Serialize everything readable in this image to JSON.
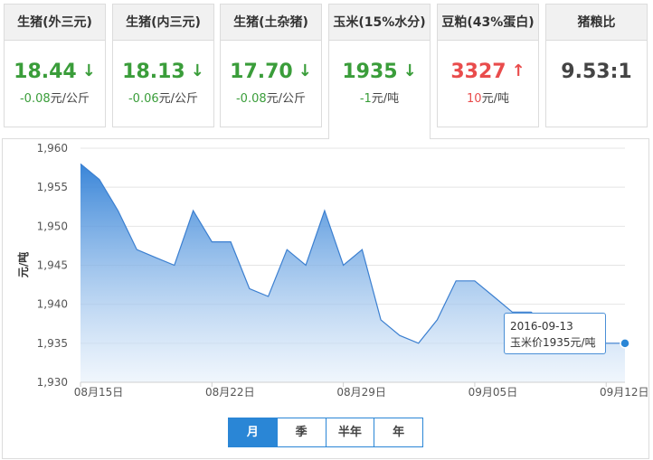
{
  "cards": [
    {
      "title": "生猪(外三元)",
      "price": "18.44",
      "arrow": "↓",
      "change": "-0.08",
      "unit": "元/公斤",
      "color": "green"
    },
    {
      "title": "生猪(内三元)",
      "price": "18.13",
      "arrow": "↓",
      "change": "-0.06",
      "unit": "元/公斤",
      "color": "green"
    },
    {
      "title": "生猪(土杂猪)",
      "price": "17.70",
      "arrow": "↓",
      "change": "-0.08",
      "unit": "元/公斤",
      "color": "green"
    },
    {
      "title": "玉米(15%水分)",
      "price": "1935",
      "arrow": "↓",
      "change": "-1",
      "unit": "元/吨",
      "color": "green"
    },
    {
      "title": "豆粕(43%蛋白)",
      "price": "3327",
      "arrow": "↑",
      "change": "10",
      "unit": "元/吨",
      "color": "red"
    },
    {
      "title": "猪粮比",
      "price": "9.53:1",
      "arrow": "",
      "change": "",
      "unit": "",
      "color": "dark"
    }
  ],
  "tooltip": {
    "date": "2016-09-13",
    "text": "玉米价1935元/吨"
  },
  "range_buttons": [
    "月",
    "季",
    "半年",
    "年"
  ],
  "colors": {
    "up": "#e94c4c",
    "down": "#3a9d3a",
    "accent": "#2a86d6"
  },
  "chart_data": {
    "type": "area",
    "ylabel": "元/吨",
    "ylim": [
      1930,
      1960
    ],
    "yticks": [
      1930,
      1935,
      1940,
      1945,
      1950,
      1955,
      1960
    ],
    "yticklabels": [
      "1,930",
      "1,935",
      "1,940",
      "1,945",
      "1,950",
      "1,955",
      "1,960"
    ],
    "xticks": [
      {
        "label": "08月15日",
        "index": 0
      },
      {
        "label": "08月22日",
        "index": 7
      },
      {
        "label": "08月29日",
        "index": 14
      },
      {
        "label": "09月05日",
        "index": 21
      },
      {
        "label": "09月12日",
        "index": 28
      }
    ],
    "values": [
      1958,
      1956,
      1952,
      1947,
      1946,
      1945,
      1952,
      1948,
      1948,
      1942,
      1941,
      1947,
      1945,
      1952,
      1945,
      1947,
      1938,
      1936,
      1935,
      1938,
      1943,
      1943,
      1941,
      1939,
      1939,
      1937,
      1937,
      1936,
      1935,
      1935
    ],
    "grid": true
  }
}
